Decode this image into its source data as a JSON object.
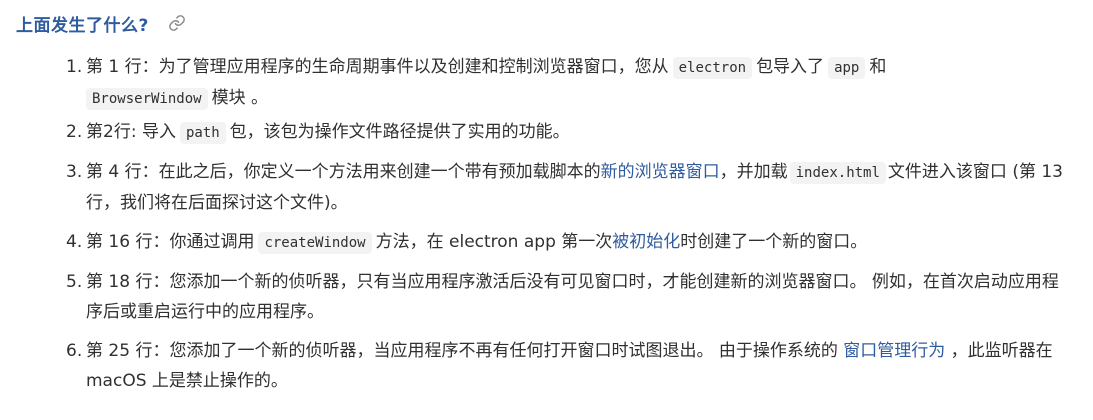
{
  "heading": {
    "title": "上面发生了什么?"
  },
  "colors": {
    "heading": "#2f5c9e",
    "link": "#2f5c9e",
    "text": "#303030",
    "code_bg": "#f3f3f3"
  },
  "icons": {
    "anchor": "link-icon"
  },
  "items": [
    {
      "num": "1.",
      "p1": "第 1 行：为了管理应用程序的生命周期事件以及创建和控制浏览器窗口，您从",
      "c1": "electron",
      "p2": "包导入了",
      "c2": "app",
      "p3": "和",
      "c3": "BrowserWindow",
      "p4": "模块 。"
    },
    {
      "num": "2.",
      "p1": "第2行: 导入",
      "c1": "path",
      "p2": "包，该包为操作文件路径提供了实用的功能。"
    },
    {
      "num": "3.",
      "p1": "第 4 行：在此之后，你定义一个方法用来创建一个带有预加载脚本的",
      "link1": "新的浏览器窗口",
      "p2": "，并加载",
      "c1": "index.html",
      "p3": "文件进入该窗口 (第 13 行，我们将在后面探讨这个文件)。"
    },
    {
      "num": "4.",
      "p1": "第 16 行：你通过调用",
      "c1": "createWindow",
      "p2": "方法，在 electron app 第一次",
      "link1": "被初始化",
      "p3": "时创建了一个新的窗口。"
    },
    {
      "num": "5.",
      "p1": "第 18 行：您添加一个新的侦听器，只有当应用程序激活后没有可见窗口时，才能创建新的浏览器窗口。 例如，在首次启动应用程序后或重启运行中的应用程序。"
    },
    {
      "num": "6.",
      "p1": "第 25 行：您添加了一个新的侦听器，当应用程序不再有任何打开窗口时试图退出。 由于操作系统的 ",
      "link1": "窗口管理行为",
      "p2": " ，此监听器在 macOS 上是禁止操作的。"
    }
  ]
}
